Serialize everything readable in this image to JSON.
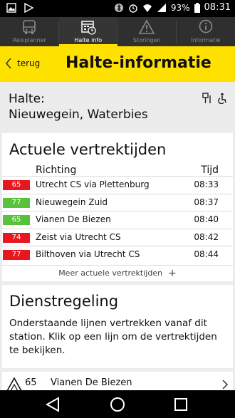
{
  "status_bar": {
    "left_icons": [
      "image-icon",
      "play-store-icon"
    ],
    "right_icons": [
      "bluetooth-icon",
      "alarm-icon",
      "wifi-icon",
      "signal-icon"
    ],
    "battery": "93%",
    "time": "08:31"
  },
  "tabs": [
    {
      "label": "Reisplanner",
      "icon": "bus-icon",
      "active": false
    },
    {
      "label": "Halte info",
      "icon": "schedule-icon",
      "active": true
    },
    {
      "label": "Storingen",
      "icon": "warning-icon",
      "active": false
    },
    {
      "label": "Informatie",
      "icon": "info-icon",
      "active": false
    }
  ],
  "header": {
    "back_label": "terug",
    "title": "Halte-informatie",
    "accent_color": "#ffe100"
  },
  "halte": {
    "label": "Halte:",
    "name": "Nieuwegein, Waterbies",
    "icons": [
      "stop-sign-icon",
      "wheelchair-icon"
    ]
  },
  "departures": {
    "title": "Actuele vertrektijden",
    "col_richting": "Richting",
    "col_tijd": "Tijd",
    "rows": [
      {
        "line": "65",
        "color": "#e8171f",
        "destination": "Utrecht CS via Plettenburg",
        "time": "08:33"
      },
      {
        "line": "77",
        "color": "#58c23a",
        "destination": "Nieuwegein Zuid",
        "time": "08:37"
      },
      {
        "line": "65",
        "color": "#58c23a",
        "destination": "Vianen De Biezen",
        "time": "08:40"
      },
      {
        "line": "74",
        "color": "#e8171f",
        "destination": "Zeist via Utrecht CS",
        "time": "08:42"
      },
      {
        "line": "77",
        "color": "#e8171f",
        "destination": "Bilthoven via Utrecht CS",
        "time": "08:44"
      }
    ],
    "more_label": "Meer actuele vertrektijden",
    "more_icon": "+"
  },
  "dienstregeling": {
    "title": "Dienstregeling",
    "description": "Onderstaande lijnen vertrekken vanaf dit station. Klik op een lijn om de vertrektijden te bekijken."
  },
  "lines": [
    {
      "number": "65",
      "destination": "Vianen De Biezen"
    }
  ]
}
